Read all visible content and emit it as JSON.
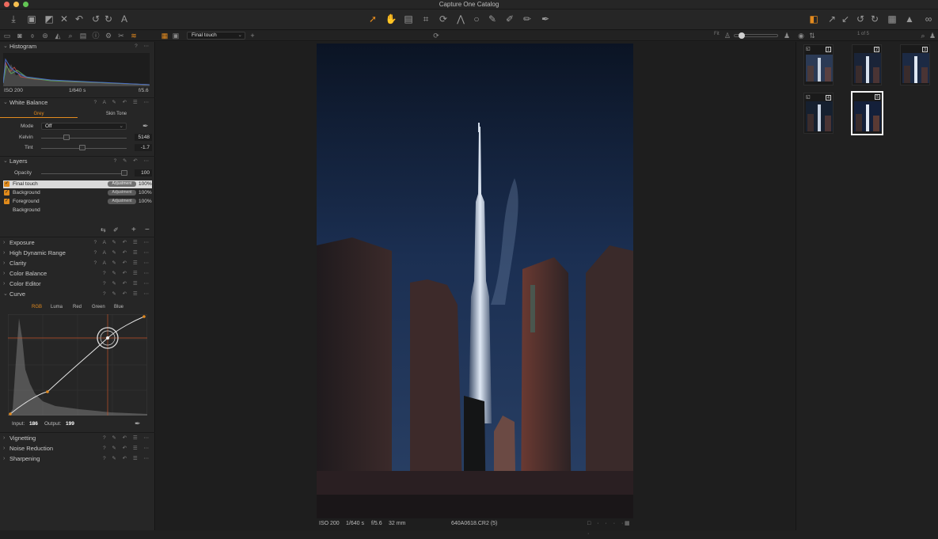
{
  "app": {
    "window_title": "Capture One Catalog"
  },
  "colors": {
    "accent": "#e38a1e",
    "panel": "#262626",
    "viewer_bg": "#1e1e1e"
  },
  "toolbar": {
    "left_icons": [
      "import-icon",
      "camera-icon",
      "batch-icon",
      "delete-icon",
      "undo-history-icon",
      "undo-icon",
      "redo-icon",
      "text-icon"
    ],
    "center_icons": [
      "select-cursor-icon",
      "pan-icon",
      "loupe-icon",
      "crop-icon",
      "rotate-icon",
      "keystone-icon",
      "spot-icon",
      "picker-icon",
      "brush-icon",
      "eraser-icon",
      "gradient-icon",
      "annotate-icon"
    ],
    "right_icons": [
      "multi-view-icon",
      "expand-icon",
      "collapse-icon",
      "rotate-left-icon",
      "rotate-right-icon",
      "grid-icon",
      "warning-icon",
      "glasses-icon"
    ]
  },
  "tabbar": {
    "variant_selector": "Final touch",
    "fit_label": "Fit",
    "count": "1 of 5"
  },
  "sidebar": {
    "histogram": {
      "label": "Histogram",
      "iso": "ISO 200",
      "shutter": "1/640 s",
      "aperture": "f/5.6"
    },
    "white_balance": {
      "label": "White Balance",
      "tabs": [
        "Grey",
        "Skin Tone"
      ],
      "mode_label": "Mode",
      "mode_value": "Off",
      "kelvin_label": "Kelvin",
      "kelvin_value": "5148",
      "kelvin_level": 0.3,
      "tint_label": "Tint",
      "tint_value": "-1.7",
      "tint_level": 0.48
    },
    "layers": {
      "label": "Layers",
      "opacity_label": "Opacity",
      "opacity_value": "100",
      "items": [
        {
          "name": "Final touch",
          "badge": "Adjustment",
          "pct": "100%",
          "checked": true,
          "selected": true
        },
        {
          "name": "Background",
          "badge": "Adjustment",
          "pct": "100%",
          "checked": true
        },
        {
          "name": "Foreground",
          "badge": "Adjustment",
          "pct": "100%",
          "checked": true
        },
        {
          "name": "Background",
          "badge": "",
          "pct": "",
          "checked": false
        }
      ]
    },
    "tools": [
      "Exposure",
      "High Dynamic Range",
      "Clarity",
      "Color Balance",
      "Color Editor"
    ],
    "curve": {
      "label": "Curve",
      "channels": [
        "RGB",
        "Luma",
        "Red",
        "Green",
        "Blue"
      ],
      "input_label": "Input:",
      "input_value": "186",
      "output_label": "Output:",
      "output_value": "199"
    },
    "tools_after": [
      "Vignetting",
      "Noise Reduction",
      "Sharpening"
    ]
  },
  "viewer": {
    "iso": "ISO 200",
    "shutter": "1/640 s",
    "aperture": "f/5.6",
    "focal": "32 mm",
    "filename": "640A0618.CR2 (5)"
  },
  "browser": {
    "thumbs": [
      "1",
      "2",
      "3",
      "4",
      "5"
    ],
    "selected": "5"
  }
}
